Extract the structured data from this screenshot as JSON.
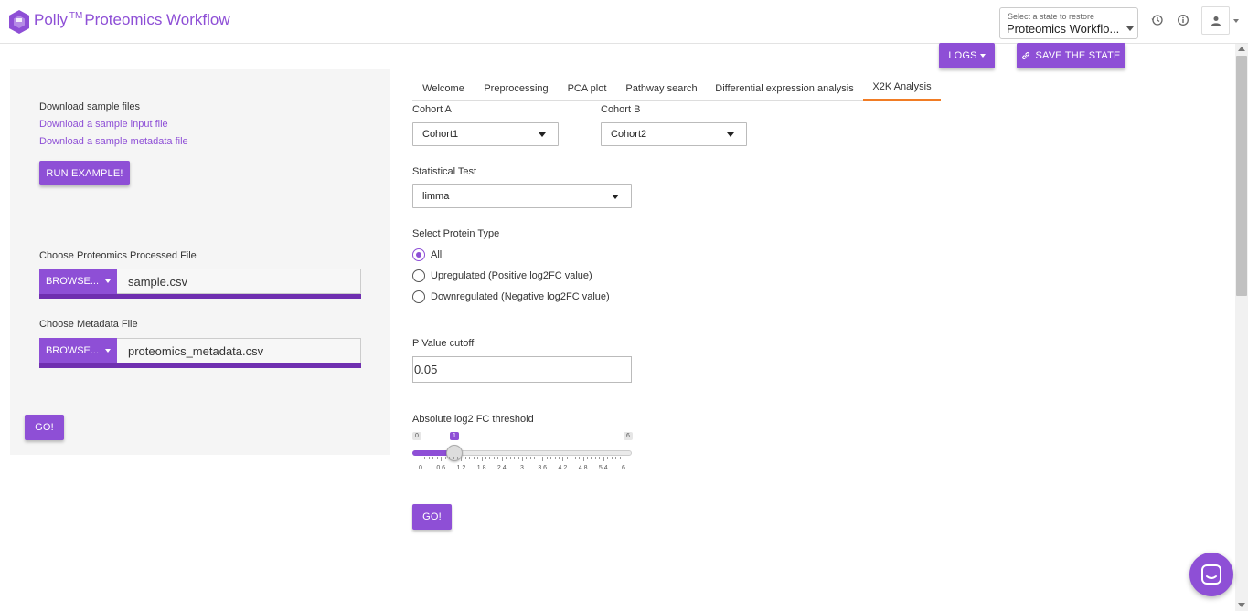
{
  "header": {
    "brand_name": "Polly",
    "brand_tm": "TM",
    "brand_suffix": "Proteomics Workflow",
    "state_select": {
      "label": "Select a state to restore",
      "value": "Proteomics Workflo..."
    },
    "icons": [
      "history-icon",
      "info-icon",
      "user-icon"
    ]
  },
  "toolbar": {
    "logs_label": "LOGS",
    "save_state_label": "SAVE THE STATE"
  },
  "left_panel": {
    "download_heading": "Download sample files",
    "download_input_link": "Download a sample input file",
    "download_metadata_link": "Download a sample metadata file",
    "run_example_label": "RUN EXAMPLE!",
    "processed_file_label": "Choose Proteomics Processed File",
    "processed_browse_label": "BROWSE...",
    "processed_file_name": "sample.csv",
    "metadata_file_label": "Choose Metadata File",
    "metadata_browse_label": "BROWSE...",
    "metadata_file_name": "proteomics_metadata.csv",
    "go_label": "GO!"
  },
  "tabs": [
    {
      "label": "Welcome",
      "active": false
    },
    {
      "label": "Preprocessing",
      "active": false
    },
    {
      "label": "PCA plot",
      "active": false
    },
    {
      "label": "Pathway search",
      "active": false
    },
    {
      "label": "Differential expression analysis",
      "active": false
    },
    {
      "label": "X2K Analysis",
      "active": true
    }
  ],
  "form": {
    "cohort_a": {
      "label": "Cohort A",
      "value": "Cohort1"
    },
    "cohort_b": {
      "label": "Cohort B",
      "value": "Cohort2"
    },
    "statistical_test": {
      "label": "Statistical Test",
      "value": "limma"
    },
    "protein_type": {
      "label": "Select Protein Type",
      "options": [
        "All",
        "Upregulated (Positive log2FC value)",
        "Downregulated (Negative log2FC value)"
      ],
      "selected": "All"
    },
    "p_value": {
      "label": "P Value cutoff",
      "value": "0.05"
    },
    "log2fc": {
      "label": "Absolute log2 FC threshold",
      "min": "0",
      "max": "6",
      "value": "1",
      "ticks": [
        "0",
        "0.6",
        "1.2",
        "1.8",
        "2.4",
        "3",
        "3.6",
        "4.2",
        "4.8",
        "5.4",
        "6"
      ]
    },
    "go_label": "GO!"
  },
  "colors": {
    "accent": "#8e4fd6",
    "tab_active": "#f17c24",
    "panel_bg": "#f5f5f5"
  }
}
